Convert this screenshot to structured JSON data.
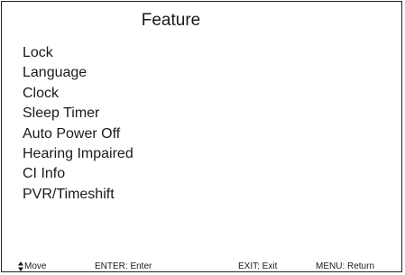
{
  "menu": {
    "title": "Feature",
    "items": [
      "Lock",
      "Language",
      "Clock",
      "Sleep Timer",
      "Auto Power Off",
      "Hearing Impaired",
      "CI Info",
      "PVR/Timeshift"
    ]
  },
  "footer": {
    "move_icon": "up-down-arrow-icon",
    "move_label": "Move",
    "enter_label": "ENTER: Enter",
    "exit_label": "EXIT: Exit",
    "menu_label": "MENU: Return"
  }
}
